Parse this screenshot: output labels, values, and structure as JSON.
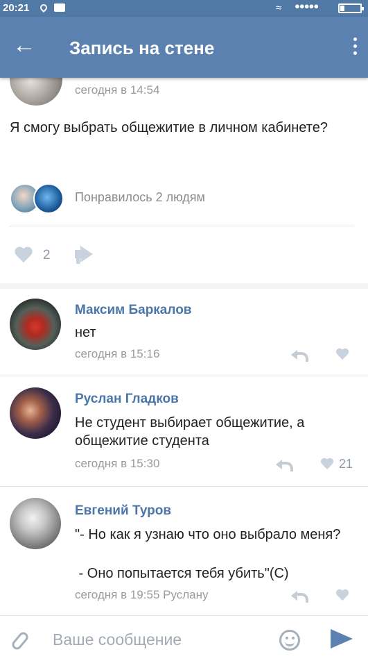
{
  "status_bar": {
    "time": "20:21"
  },
  "header": {
    "title": "Запись на стене",
    "back_icon": "arrow-left-icon",
    "menu_icon": "more-vertical-icon"
  },
  "post": {
    "time": "сегодня в 14:54",
    "text": "Я смогу выбрать общежитие в личном кабинете?",
    "likers_text": "Понравилось 2 людям",
    "like_count": "2"
  },
  "comments": [
    {
      "name": "Максим Баркалов",
      "text": "нет",
      "time": "сегодня в 15:16",
      "likes": ""
    },
    {
      "name": "Руслан Гладков",
      "text": "Не студент выбирает общежитие, а общежитие студента",
      "time": "сегодня в 15:30",
      "likes": "21"
    },
    {
      "name": "Евгений Туров",
      "text_line1": "\"- Но как я узнаю что оно выбрало меня?",
      "text_line2": " - Оно попытается тебя убить\"(С)",
      "time": "сегодня в 19:55 Руслану",
      "likes": ""
    }
  ],
  "composer": {
    "placeholder": "Ваше сообщение"
  },
  "colors": {
    "header": "#5a81b0",
    "link": "#4a76a8",
    "icon_gray": "#c9d3dd"
  }
}
